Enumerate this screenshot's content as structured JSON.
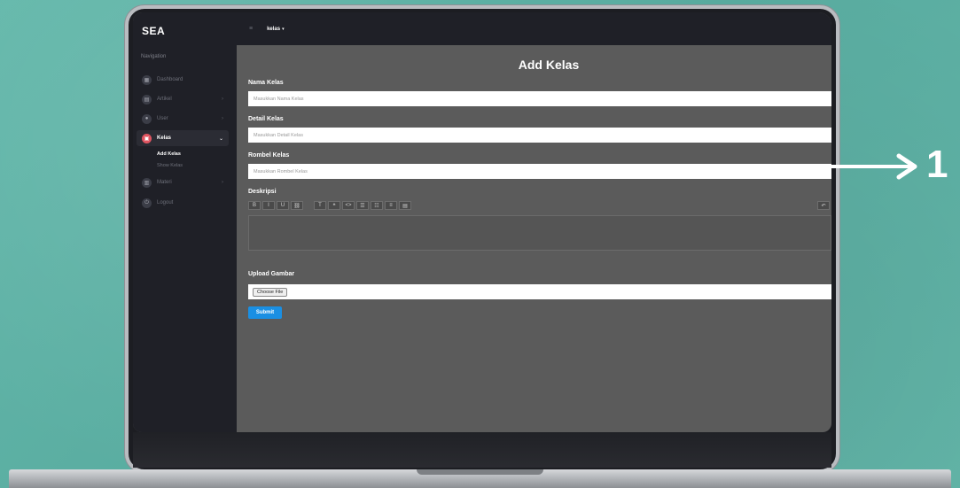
{
  "sidebar": {
    "brand": "SEA",
    "heading": "Navigation",
    "items": [
      {
        "label": "Dashboard",
        "icon": "dashboard-icon",
        "glyph": "▦"
      },
      {
        "label": "Artikel",
        "icon": "article-icon",
        "glyph": "▤"
      },
      {
        "label": "User",
        "icon": "user-icon",
        "glyph": "●"
      },
      {
        "label": "Kelas",
        "icon": "class-icon",
        "glyph": "▣",
        "active": true
      },
      {
        "label": "Materi",
        "icon": "material-icon",
        "glyph": "▥"
      },
      {
        "label": "Logout",
        "icon": "logout-icon",
        "glyph": "⏻"
      }
    ],
    "sub_items": [
      {
        "label": "Add Kelas",
        "active": true
      },
      {
        "label": "Show Kelas"
      }
    ]
  },
  "topbar": {
    "menu_glyph": "≡",
    "title": "kelas",
    "chevron": "▾"
  },
  "form": {
    "title": "Add Kelas",
    "nama_label": "Nama Kelas",
    "nama_placeholder": "Masukkan Nama Kelas",
    "detail_label": "Detail Kelas",
    "detail_placeholder": "Masukkan Detail Kelas",
    "rombel_label": "Rombel Kelas",
    "rombel_placeholder": "Masukkan Rombel Kelas",
    "deskripsi_label": "Deskripsi",
    "upload_label": "Upload Gambar",
    "file_button": "Choose File",
    "submit": "Submit"
  },
  "toolbar": {
    "bold": "B",
    "italic": "I",
    "underline": "U",
    "link": "⛓",
    "font": "T",
    "quote": "❝",
    "code": "<>",
    "ul": "☰",
    "ol": "☷",
    "align": "≡",
    "more": "▤",
    "undo": "↶"
  },
  "annotation": {
    "number": "1"
  }
}
